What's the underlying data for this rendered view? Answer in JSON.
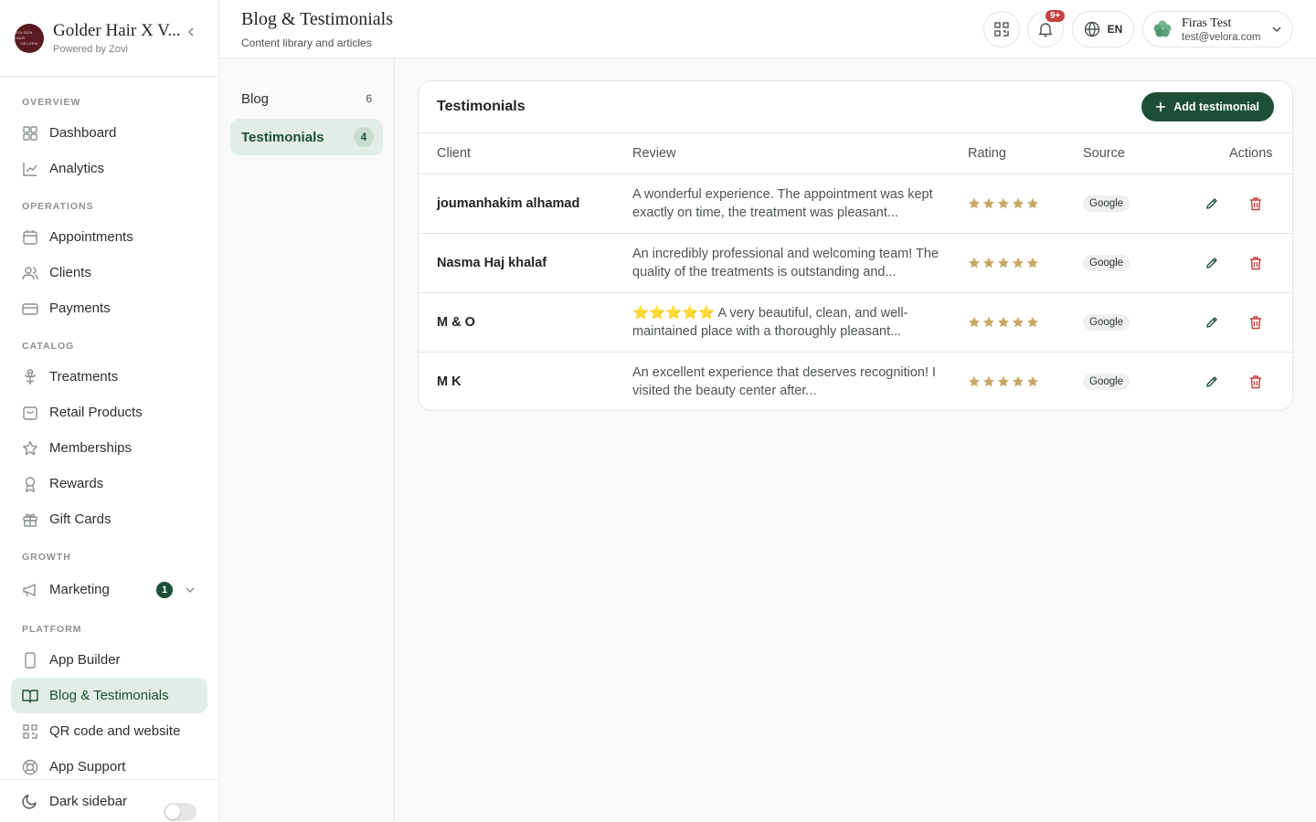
{
  "brand": {
    "name": "Golder Hair X V...",
    "powered_by": "Powered by Zovi",
    "logo_line1": "GOLDEN HAIR",
    "logo_line2": "VELORA"
  },
  "sidebar": {
    "sections": {
      "overview": "OVERVIEW",
      "operations": "OPERATIONS",
      "catalog": "CATALOG",
      "growth": "GROWTH",
      "platform": "PLATFORM"
    },
    "items": {
      "dashboard": "Dashboard",
      "analytics": "Analytics",
      "appointments": "Appointments",
      "clients": "Clients",
      "payments": "Payments",
      "treatments": "Treatments",
      "retail_products": "Retail Products",
      "memberships": "Memberships",
      "rewards": "Rewards",
      "gift_cards": "Gift Cards",
      "marketing": "Marketing",
      "marketing_badge": "1",
      "app_builder": "App Builder",
      "blog_testimonials": "Blog & Testimonials",
      "qr_code": "QR code and website",
      "app_support": "App Support"
    },
    "footer": {
      "dark_sidebar": "Dark sidebar",
      "dark_sidebar_on": false
    }
  },
  "header": {
    "title": "Blog & Testimonials",
    "subtitle": "Content library and articles",
    "notification_badge": "9+",
    "language": "EN",
    "user": {
      "name": "Firas Test",
      "email": "test@velora.com"
    }
  },
  "subnav": [
    {
      "label": "Blog",
      "count": "6"
    },
    {
      "label": "Testimonials",
      "count": "4"
    }
  ],
  "card": {
    "title": "Testimonials",
    "add_button": "Add testimonial",
    "columns": {
      "client": "Client",
      "review": "Review",
      "rating": "Rating",
      "source": "Source",
      "actions": "Actions"
    },
    "rows": [
      {
        "client": "joumanhakim alhamad",
        "review": "A wonderful experience. The appointment was kept exactly on time, the treatment was pleasant...",
        "rating": 5,
        "source": "Google"
      },
      {
        "client": "Nasma Haj khalaf",
        "review": "An incredibly professional and welcoming team! The quality of the treatments is outstanding and...",
        "rating": 5,
        "source": "Google"
      },
      {
        "client": "M & O",
        "review": "⭐⭐⭐⭐⭐ A very beautiful, clean, and well-maintained place with a thoroughly pleasant...",
        "rating": 5,
        "source": "Google"
      },
      {
        "client": "M K",
        "review": "An excellent experience that deserves recognition! I visited the beauty center after...",
        "rating": 5,
        "source": "Google"
      }
    ]
  },
  "colors": {
    "accent": "#1d4f38",
    "active_bg": "#e3ede7",
    "star": "#c9a865",
    "danger": "#c2403d"
  }
}
